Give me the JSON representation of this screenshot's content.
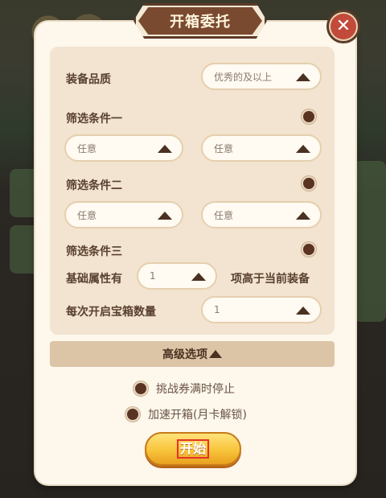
{
  "dialog": {
    "title": "开箱委托",
    "close_icon": "close-icon"
  },
  "quality": {
    "label": "装备品质",
    "value": "优秀的及以上"
  },
  "filter1": {
    "label": "筛选条件一",
    "option_a": "任意",
    "option_b": "任意"
  },
  "filter2": {
    "label": "筛选条件二",
    "option_a": "任意",
    "option_b": "任意"
  },
  "filter3": {
    "label": "筛选条件三",
    "prefix": "基础属性有",
    "value": "1",
    "suffix": "项高于当前装备"
  },
  "chest_count": {
    "label": "每次开启宝箱数量",
    "value": "1"
  },
  "advanced": {
    "label": "高级选项"
  },
  "options": {
    "stop_when_full": "挑战券满时停止",
    "speed_up": "加速开箱(月卡解锁)"
  },
  "start_button": {
    "label": "开始"
  },
  "colors": {
    "panel": "#f2e4d0",
    "radio": "#5a3322",
    "button": "#f8c43a",
    "title_bg": "#7a4a30"
  }
}
